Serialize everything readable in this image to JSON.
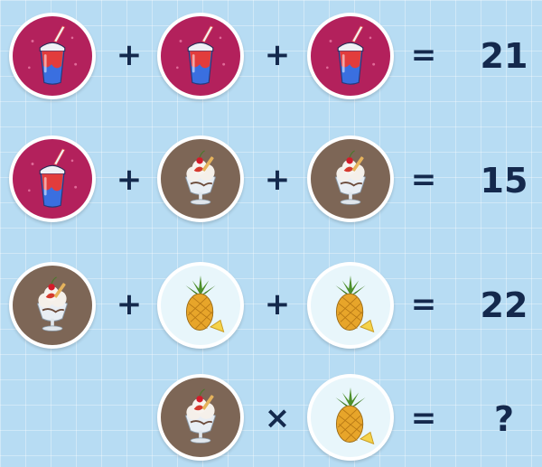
{
  "rows": [
    {
      "items": [
        "soda-cup",
        "soda-cup",
        "soda-cup"
      ],
      "ops": [
        "+",
        "+"
      ],
      "equals": "=",
      "result": "21"
    },
    {
      "items": [
        "soda-cup",
        "ice-cream-sundae",
        "ice-cream-sundae"
      ],
      "ops": [
        "+",
        "+"
      ],
      "equals": "=",
      "result": "15"
    },
    {
      "items": [
        "ice-cream-sundae",
        "pineapple",
        "pineapple"
      ],
      "ops": [
        "+",
        "+"
      ],
      "equals": "=",
      "result": "22"
    },
    {
      "items": [
        "ice-cream-sundae",
        "pineapple"
      ],
      "ops": [
        "×"
      ],
      "equals": "=",
      "result": "?"
    }
  ],
  "colors": {
    "background": "#b7dcf3",
    "text": "#14294d",
    "drink_circle": "#b3215c",
    "sundae_circle": "#7d6656",
    "pineapple_circle": "#e8f6fb"
  }
}
